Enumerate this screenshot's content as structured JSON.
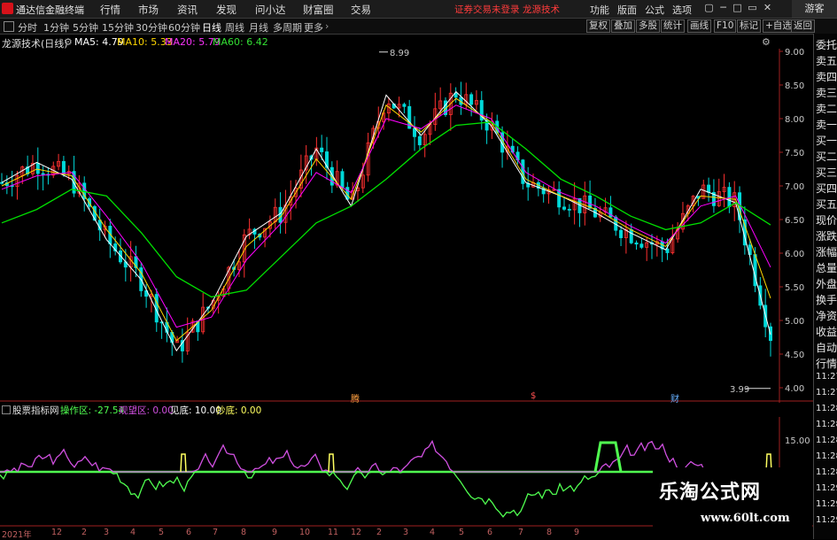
{
  "menubar": {
    "app_title": "通达信金融终端",
    "menus": [
      "行情",
      "市场",
      "资讯",
      "发现",
      "问小达",
      "财富圈",
      "交易"
    ],
    "notice_left": "证券交易未登录",
    "notice_right": "龙源技术",
    "right_menus": [
      "功能",
      "版面",
      "公式",
      "选项"
    ],
    "guest": "游客"
  },
  "toolbar": {
    "periods": [
      "分时",
      "1分钟",
      "5分钟",
      "15分钟",
      "30分钟",
      "60分钟",
      "日线",
      "周线",
      "月线",
      "多周期",
      "更多"
    ],
    "active_period": "日线",
    "right_buttons": [
      "复权",
      "叠加",
      "多股",
      "统计",
      "画线",
      "F10",
      "标记",
      "+自选",
      "返回"
    ]
  },
  "chart_header": {
    "stock": "龙源技术(日线)",
    "ma5_label": "MA5: 4.79",
    "ma10_label": "MA10: 5.33",
    "ma20_label": "MA20: 5.79",
    "ma60_label": "MA60: 6.42"
  },
  "side_panel": [
    "委托",
    "卖五",
    "卖四",
    "卖三",
    "卖二",
    "卖一",
    "买一",
    "买二",
    "买三",
    "买四",
    "买五",
    "现价",
    "涨跌",
    "涨幅",
    "总量",
    "外盘",
    "换手",
    "净资",
    "收益",
    "自动",
    "行情",
    "11:27",
    "11:27",
    "11:28",
    "11:28",
    "11:28",
    "11:28",
    "11:28",
    "11:29",
    "11:29",
    "11:29"
  ],
  "events": {
    "e1": "腾",
    "e2": "$",
    "e3": "财"
  },
  "annotations": {
    "high": "8.99",
    "low": "3.99"
  },
  "indicator": {
    "name": "股票指标网",
    "op_label": "操作区: -27.54",
    "watch_label": "观望区: 0.00",
    "bottom_label": "见底: 10.00",
    "buy_label": "抄底: 0.00",
    "yticks": [
      "15.00"
    ]
  },
  "x_axis": [
    "2021年",
    "12",
    "2",
    "3",
    "4",
    "5",
    "6",
    "7",
    "8",
    "9",
    "10",
    "11",
    "12",
    "2",
    "3",
    "4",
    "5",
    "6",
    "7",
    "8",
    "9"
  ],
  "watermark": {
    "title": "乐淘公式网",
    "url": "www.60lt.com"
  },
  "colors": {
    "ma5": "#ffffff",
    "ma10": "#ffd700",
    "ma20": "#ff00ff",
    "ma60": "#00e000",
    "up": "#ff3030",
    "down": "#00d8d8",
    "indicator_purple": "#d050e0",
    "indicator_green": "#50ff50",
    "indicator_yellow": "#ffff60"
  },
  "chart_data": {
    "type": "line",
    "title": "龙源技术(日线)",
    "ylim": [
      4.0,
      9.0
    ],
    "yticks": [
      9.0,
      8.5,
      8.0,
      7.5,
      7.0,
      6.5,
      6.0,
      5.5,
      5.0,
      4.5,
      4.0
    ],
    "x": [
      "2020-11",
      "2020-12",
      "2021-01",
      "2021-02",
      "2021-03",
      "2021-04",
      "2021-05",
      "2021-06",
      "2021-07",
      "2021-08",
      "2021-09",
      "2021-10",
      "2021-11",
      "2021-12",
      "2022-01",
      "2022-02",
      "2022-03",
      "2022-04",
      "2022-05",
      "2022-06",
      "2022-07",
      "2022-08",
      "2022-09"
    ],
    "series": [
      {
        "name": "MA5",
        "values": [
          7.05,
          7.35,
          7.1,
          6.2,
          5.6,
          4.55,
          5.25,
          6.25,
          6.6,
          7.55,
          6.7,
          8.35,
          7.75,
          8.4,
          7.9,
          7.05,
          6.85,
          6.6,
          6.3,
          6.05,
          6.95,
          6.75,
          4.79
        ]
      },
      {
        "name": "MA10",
        "values": [
          7.0,
          7.25,
          7.15,
          6.35,
          5.7,
          4.7,
          5.15,
          6.1,
          6.55,
          7.4,
          6.8,
          8.2,
          7.8,
          8.3,
          7.95,
          7.1,
          6.85,
          6.65,
          6.35,
          6.1,
          6.85,
          6.8,
          5.33
        ]
      },
      {
        "name": "MA20",
        "values": [
          6.95,
          7.15,
          7.2,
          6.55,
          5.85,
          4.9,
          5.05,
          5.9,
          6.45,
          7.2,
          6.9,
          8.0,
          7.85,
          8.2,
          8.0,
          7.2,
          6.9,
          6.7,
          6.4,
          6.15,
          6.7,
          6.85,
          5.79
        ]
      },
      {
        "name": "MA60",
        "values": [
          6.45,
          6.65,
          6.95,
          6.85,
          6.3,
          5.65,
          5.35,
          5.45,
          5.95,
          6.45,
          6.7,
          7.1,
          7.55,
          7.9,
          7.95,
          7.55,
          7.1,
          6.85,
          6.55,
          6.35,
          6.45,
          6.75,
          6.42
        ]
      }
    ]
  }
}
